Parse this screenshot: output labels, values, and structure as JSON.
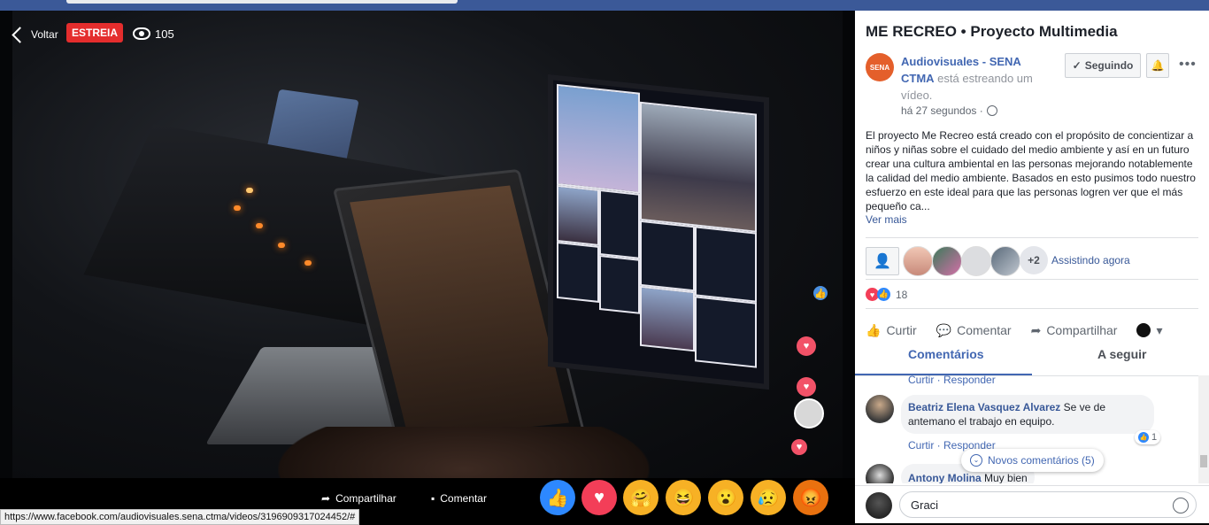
{
  "video": {
    "back_label": "Voltar",
    "live_badge": "ESTREIA",
    "viewer_count": "105",
    "share_label": "Compartilhar",
    "comment_label": "Comentar",
    "reactions": [
      "like",
      "love",
      "care",
      "haha",
      "wow",
      "sad",
      "angry"
    ]
  },
  "status_url": "https://www.facebook.com/audiovisuales.sena.ctma/videos/3196909317024452/#",
  "sidebar": {
    "title": "ME RECREO • Proyecto Multimedia",
    "page_logo_text": "SENA",
    "poster_name": "Audiovisuales - SENA CTMA",
    "poster_action": "está estreando um vídeo.",
    "time": "há 27 segundos ·",
    "follow_label": "Seguindo",
    "description": "El proyecto Me Recreo está creado con el propósito de concientizar a niños y niñas sobre el cuidado del medio ambiente y así en un futuro crear una cultura ambiental en las personas mejorando notablemente la calidad del medio ambiente. Basados en esto pusimos todo nuestro esfuerzo en este ideal para que las personas logren ver que el más pequeño ca...",
    "see_more": "Ver mais",
    "watchers_extra": "+2",
    "watching_now": "Assistindo agora",
    "reaction_count": "18",
    "actions": {
      "like": "Curtir",
      "comment": "Comentar",
      "share": "Compartilhar"
    },
    "tabs": {
      "comments": "Comentários",
      "following": "A seguir"
    },
    "comments": [
      {
        "links": "Curtir · Responder"
      },
      {
        "author": "Beatriz Elena Vasquez Alvarez",
        "text": "Se ve de antemano el trabajo en equipo.",
        "links": "Curtir · Responder",
        "likes": "1"
      },
      {
        "author": "Antony Molina",
        "text": "Muy bien"
      }
    ],
    "new_comments": "Novos comentários (5)",
    "composer_value": "Graci"
  },
  "colors": {
    "fb_blue": "#3b5998",
    "link": "#4267b2",
    "live_red": "#e42d2d",
    "love": "#f25268"
  }
}
